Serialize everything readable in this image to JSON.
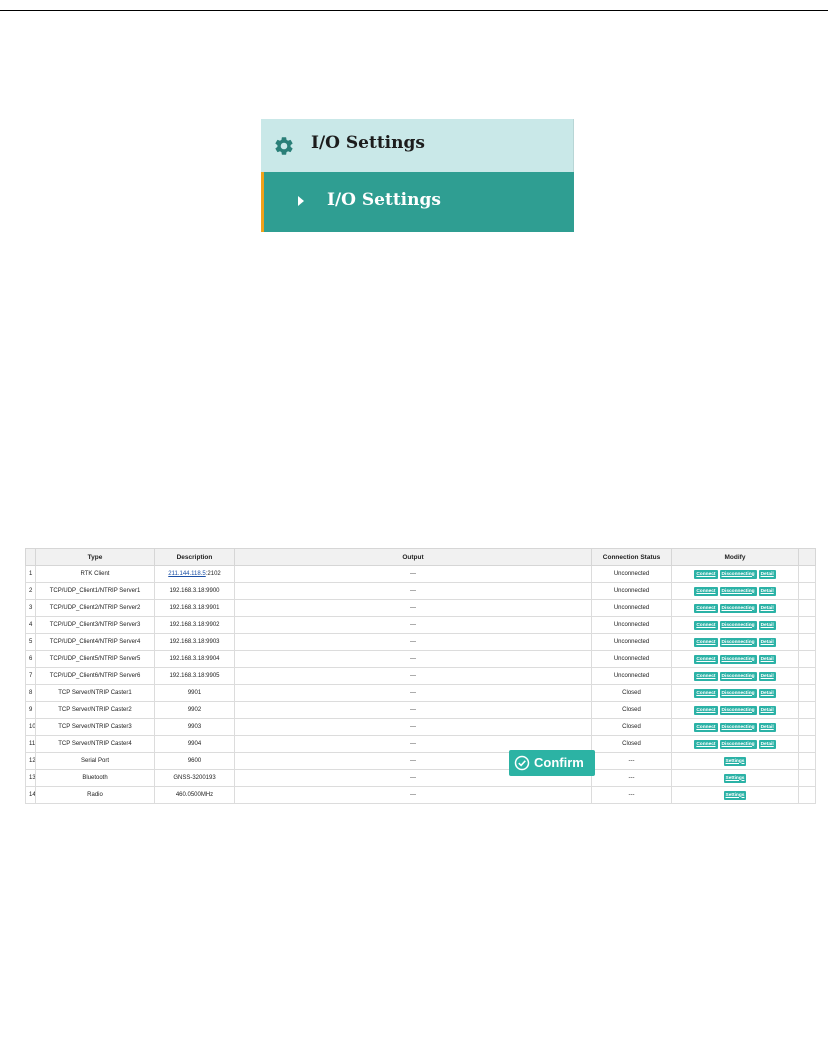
{
  "menu": {
    "header_title": "I/O Settings",
    "item_label": "I/O Settings"
  },
  "table": {
    "headers": [
      "",
      "Type",
      "Description",
      "Output",
      "Connection Status",
      "Modify"
    ],
    "rows": [
      {
        "index": "1",
        "type": "RTK Client",
        "desc_link": "211.144.118.5",
        "desc_rest": ":2102",
        "output": "---",
        "status": "Unconnected",
        "actions": [
          "Connect",
          "Disconnecting",
          "Detail"
        ]
      },
      {
        "index": "2",
        "type": "TCP/UDP_Client1/NTRIP Server1",
        "desc_link": "",
        "desc_rest": "192.168.3.18:9900",
        "output": "---",
        "status": "Unconnected",
        "actions": [
          "Connect",
          "Disconnecting",
          "Detail"
        ]
      },
      {
        "index": "3",
        "type": "TCP/UDP_Client2/NTRIP Server2",
        "desc_link": "",
        "desc_rest": "192.168.3.18:9901",
        "output": "---",
        "status": "Unconnected",
        "actions": [
          "Connect",
          "Disconnecting",
          "Detail"
        ]
      },
      {
        "index": "4",
        "type": "TCP/UDP_Client3/NTRIP Server3",
        "desc_link": "",
        "desc_rest": "192.168.3.18:9902",
        "output": "---",
        "status": "Unconnected",
        "actions": [
          "Connect",
          "Disconnecting",
          "Detail"
        ]
      },
      {
        "index": "5",
        "type": "TCP/UDP_Client4/NTRIP Server4",
        "desc_link": "",
        "desc_rest": "192.168.3.18:9903",
        "output": "---",
        "status": "Unconnected",
        "actions": [
          "Connect",
          "Disconnecting",
          "Detail"
        ]
      },
      {
        "index": "6",
        "type": "TCP/UDP_Client5/NTRIP Server5",
        "desc_link": "",
        "desc_rest": "192.168.3.18:9904",
        "output": "---",
        "status": "Unconnected",
        "actions": [
          "Connect",
          "Disconnecting",
          "Detail"
        ]
      },
      {
        "index": "7",
        "type": "TCP/UDP_Client6/NTRIP Server6",
        "desc_link": "",
        "desc_rest": "192.168.3.18:9905",
        "output": "---",
        "status": "Unconnected",
        "actions": [
          "Connect",
          "Disconnecting",
          "Detail"
        ]
      },
      {
        "index": "8",
        "type": "TCP Server/NTRIP Caster1",
        "desc_link": "",
        "desc_rest": "9901",
        "output": "---",
        "status": "Closed",
        "actions": [
          "Connect",
          "Disconnecting",
          "Detail"
        ]
      },
      {
        "index": "9",
        "type": "TCP Server/NTRIP Caster2",
        "desc_link": "",
        "desc_rest": "9902",
        "output": "---",
        "status": "Closed",
        "actions": [
          "Connect",
          "Disconnecting",
          "Detail"
        ]
      },
      {
        "index": "10",
        "type": "TCP Server/NTRIP Caster3",
        "desc_link": "",
        "desc_rest": "9903",
        "output": "---",
        "status": "Closed",
        "actions": [
          "Connect",
          "Disconnecting",
          "Detail"
        ]
      },
      {
        "index": "11",
        "type": "TCP Server/NTRIP Caster4",
        "desc_link": "",
        "desc_rest": "9904",
        "output": "---",
        "status": "Closed",
        "actions": [
          "Connect",
          "Disconnecting",
          "Detail"
        ]
      },
      {
        "index": "12",
        "type": "Serial Port",
        "desc_link": "",
        "desc_rest": "9600",
        "output": "---",
        "status": "---",
        "actions": [
          "Settings"
        ]
      },
      {
        "index": "13",
        "type": "Bluetooth",
        "desc_link": "",
        "desc_rest": "GNSS-3200193",
        "output": "---",
        "status": "---",
        "actions": [
          "Settings"
        ]
      },
      {
        "index": "14",
        "type": "Radio",
        "desc_link": "",
        "desc_rest": "460.0500MHz",
        "output": "---",
        "status": "---",
        "actions": [
          "Settings"
        ]
      }
    ]
  },
  "confirm_label": "Confirm",
  "colors": {
    "menu_header_bg": "#c9e8e8",
    "menu_item_bg": "#2f9e92",
    "menu_accent": "#f0a21a",
    "button_bg": "#2bb2a6",
    "link": "#1a4fa5"
  }
}
